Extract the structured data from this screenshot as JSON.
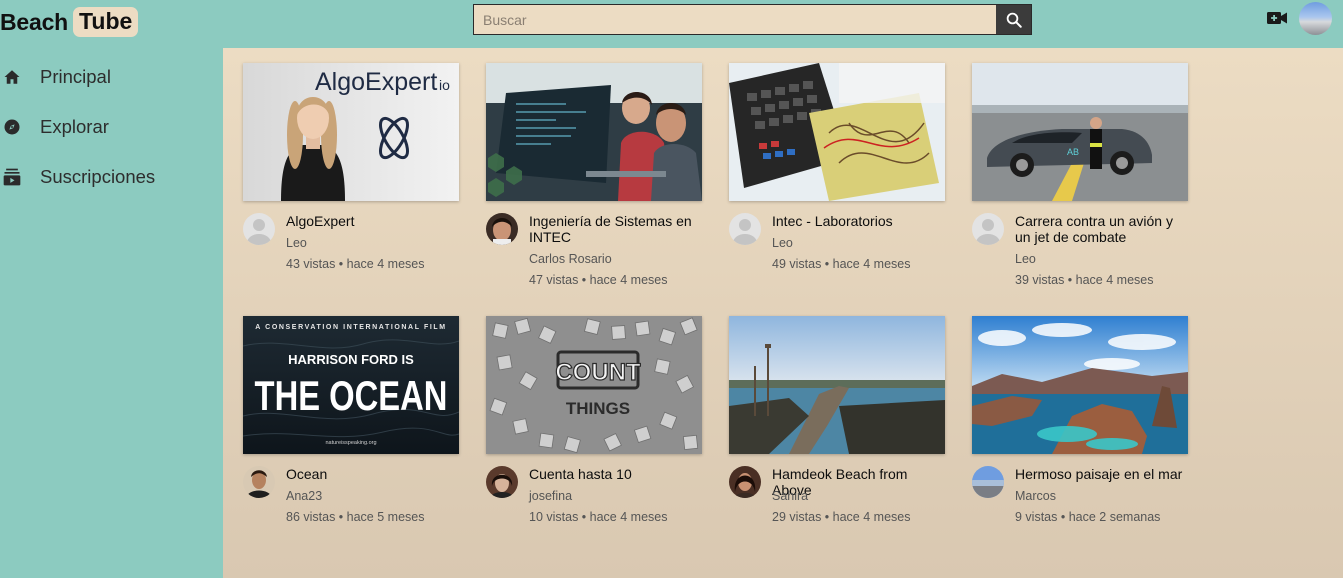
{
  "header": {
    "logo_beach": "Beach",
    "logo_tube": "Tube",
    "search_placeholder": "Buscar",
    "icons": [
      "search-icon",
      "video-camera-add-icon",
      "user-avatar"
    ]
  },
  "sidebar": {
    "items": [
      {
        "label": "Principal",
        "icon": "home-icon"
      },
      {
        "label": "Explorar",
        "icon": "compass-icon"
      },
      {
        "label": "Suscripciones",
        "icon": "subscriptions-icon"
      }
    ]
  },
  "colors": {
    "background": "#8ccbc0",
    "content": "#ecdcc3",
    "search_button": "#3b3b3b"
  },
  "videos": [
    {
      "title": "AlgoExpert",
      "channel": "Leo",
      "stats": "43 vistas • hace 4 meses",
      "thumb_text": "AlgoExpert",
      "thumb_text2": "io"
    },
    {
      "title": "Ingeniería de Sistemas en INTEC",
      "channel": "Carlos Rosario",
      "stats": "47 vistas • hace 4 meses"
    },
    {
      "title": "Intec - Laboratorios",
      "channel": "",
      "stats": "49 vistas • hace 4 meses"
    },
    {
      "title": "Carrera contra un avión y un jet de combate",
      "channel": "Leo",
      "stats": "39 vistas • hace 4 meses"
    },
    {
      "title": "Ocean",
      "channel": "Ana23",
      "stats": "86 vistas • hace 5 meses",
      "thumb_text": "A CONSERVATION INTERNATIONAL FILM",
      "thumb_text2": "HARRISON FORD IS",
      "thumb_text3": "THE OCEAN",
      "thumb_text4": "natureisspeaking.org"
    },
    {
      "title": "Cuenta hasta 10",
      "channel": "josefina",
      "stats": "10 vistas • hace 4 meses",
      "thumb_text": "COUNT",
      "thumb_text2": "THINGS"
    },
    {
      "title": "Hamdeok Beach from Above",
      "channel": "Sahira",
      "stats": "29 vistas • hace 4 meses"
    },
    {
      "title": "Hermoso paisaje en el mar",
      "channel": "Marcos",
      "stats": "9 vistas • hace 2 semanas"
    }
  ]
}
